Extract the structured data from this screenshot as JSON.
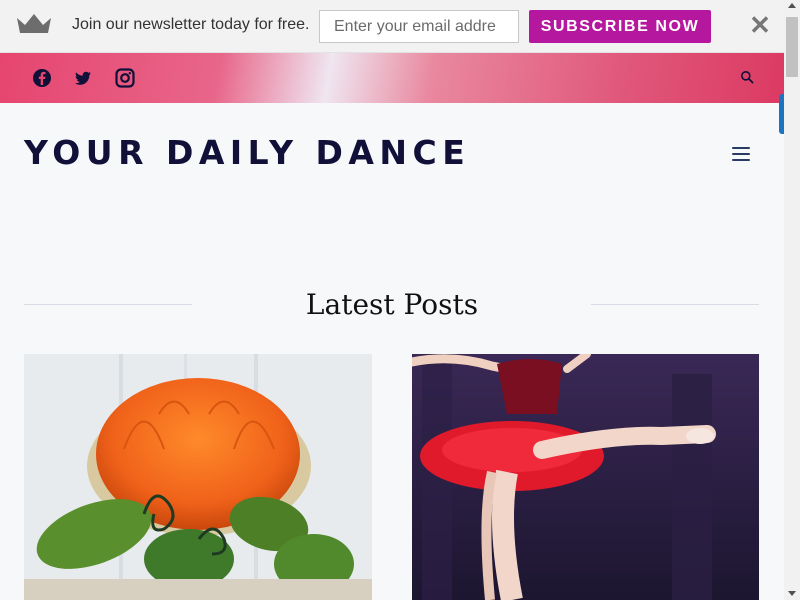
{
  "newsletter": {
    "text": "Join our newsletter today for free.",
    "email_placeholder": "Enter your email addre",
    "subscribe_label": "SUBSCRIBE NOW",
    "close_label": "✕"
  },
  "social": {
    "icons": [
      "facebook-icon",
      "twitter-icon",
      "instagram-icon"
    ],
    "search_icon": "search-icon"
  },
  "header": {
    "site_title": "YOUR DAILY DANCE",
    "menu_icon": "hamburger-menu-icon"
  },
  "latest_posts": {
    "heading": "Latest Posts",
    "posts": [
      {
        "image": "pumpkin-hat-photo"
      },
      {
        "image": "ballerina-red-tutu-photo"
      }
    ]
  },
  "colors": {
    "subscribe_button": "#b5179e",
    "title_text": "#101038",
    "social_gradient_main": "#e6456f"
  }
}
